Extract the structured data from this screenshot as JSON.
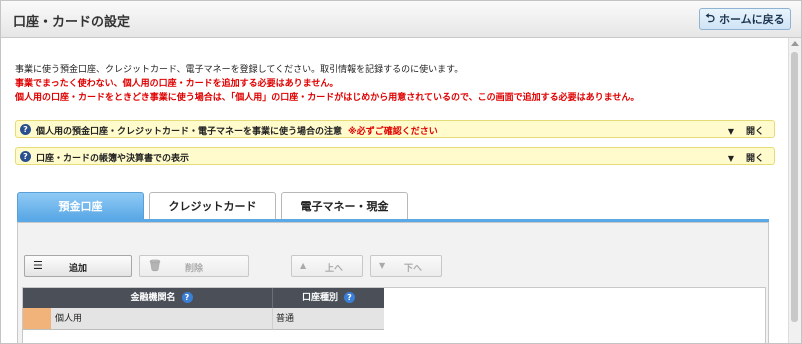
{
  "page": {
    "title": "口座・カードの設定"
  },
  "header": {
    "home_label": "ホームに戻る"
  },
  "intro": {
    "line1": "事業に使う預金口座、クレジットカード、電子マネーを登録してください。取引情報を記録するのに使います。",
    "line2": "事業でまったく使わない、個人用の口座・カードを追加する必要はありません。",
    "line3": "個人用の口座・カードをときどき事業に使う場合は、「個人用」の口座・カードがはじめから用意されているので、この画面で追加する必要はありません。"
  },
  "notices": [
    {
      "text": "個人用の預金口座・クレジットカード・電子マネーを事業に使う場合の注意",
      "warning": "※必ずご確認ください",
      "toggle": "開く"
    },
    {
      "text": "口座・カードの帳簿や決算書での表示",
      "warning": "",
      "toggle": "開く"
    }
  ],
  "tabs": [
    {
      "label": "預金口座",
      "active": true
    },
    {
      "label": "クレジットカード",
      "active": false
    },
    {
      "label": "電子マネー・現金",
      "active": false
    }
  ],
  "toolbar": {
    "add_label": "追加",
    "delete_label": "削除",
    "up_label": "上へ",
    "down_label": "下へ"
  },
  "grid": {
    "columns": [
      "金融機関名",
      "口座種別"
    ],
    "rows": [
      {
        "name": "個人用",
        "type": "普通"
      }
    ]
  },
  "colors": {
    "accent": "#5aa8e6",
    "warning": "#e00000",
    "notice_bg": "#fffbcc",
    "grid_header": "#4a4f58"
  }
}
